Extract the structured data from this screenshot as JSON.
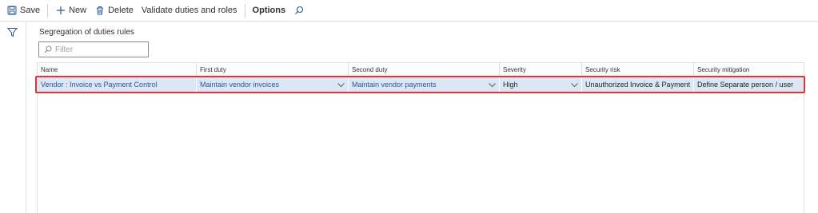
{
  "toolbar": {
    "save": "Save",
    "new": "New",
    "delete": "Delete",
    "validate": "Validate duties and roles",
    "options": "Options"
  },
  "icons": {
    "save": "save-icon",
    "new": "plus-icon",
    "delete": "trash-icon",
    "search": "search-icon",
    "filter": "funnel-icon"
  },
  "main": {
    "title": "Segregation of duties rules",
    "filter_placeholder": "Filter"
  },
  "grid": {
    "columns": [
      "Name",
      "First duty",
      "Second duty",
      "Severity",
      "Security risk",
      "Security mitigation"
    ],
    "rows": [
      {
        "name": "Vendor : Invoice vs Payment Control",
        "first_duty": "Maintain vendor invoices",
        "second_duty": "Maintain vendor payments",
        "severity": "High",
        "security_risk": "Unauthorized Invoice & Payment",
        "security_mitigation": "Define Separate person / user"
      }
    ]
  },
  "colors": {
    "accent": "#2b579a",
    "row_selected": "#dde6f4",
    "highlight_border": "#d9363e"
  }
}
